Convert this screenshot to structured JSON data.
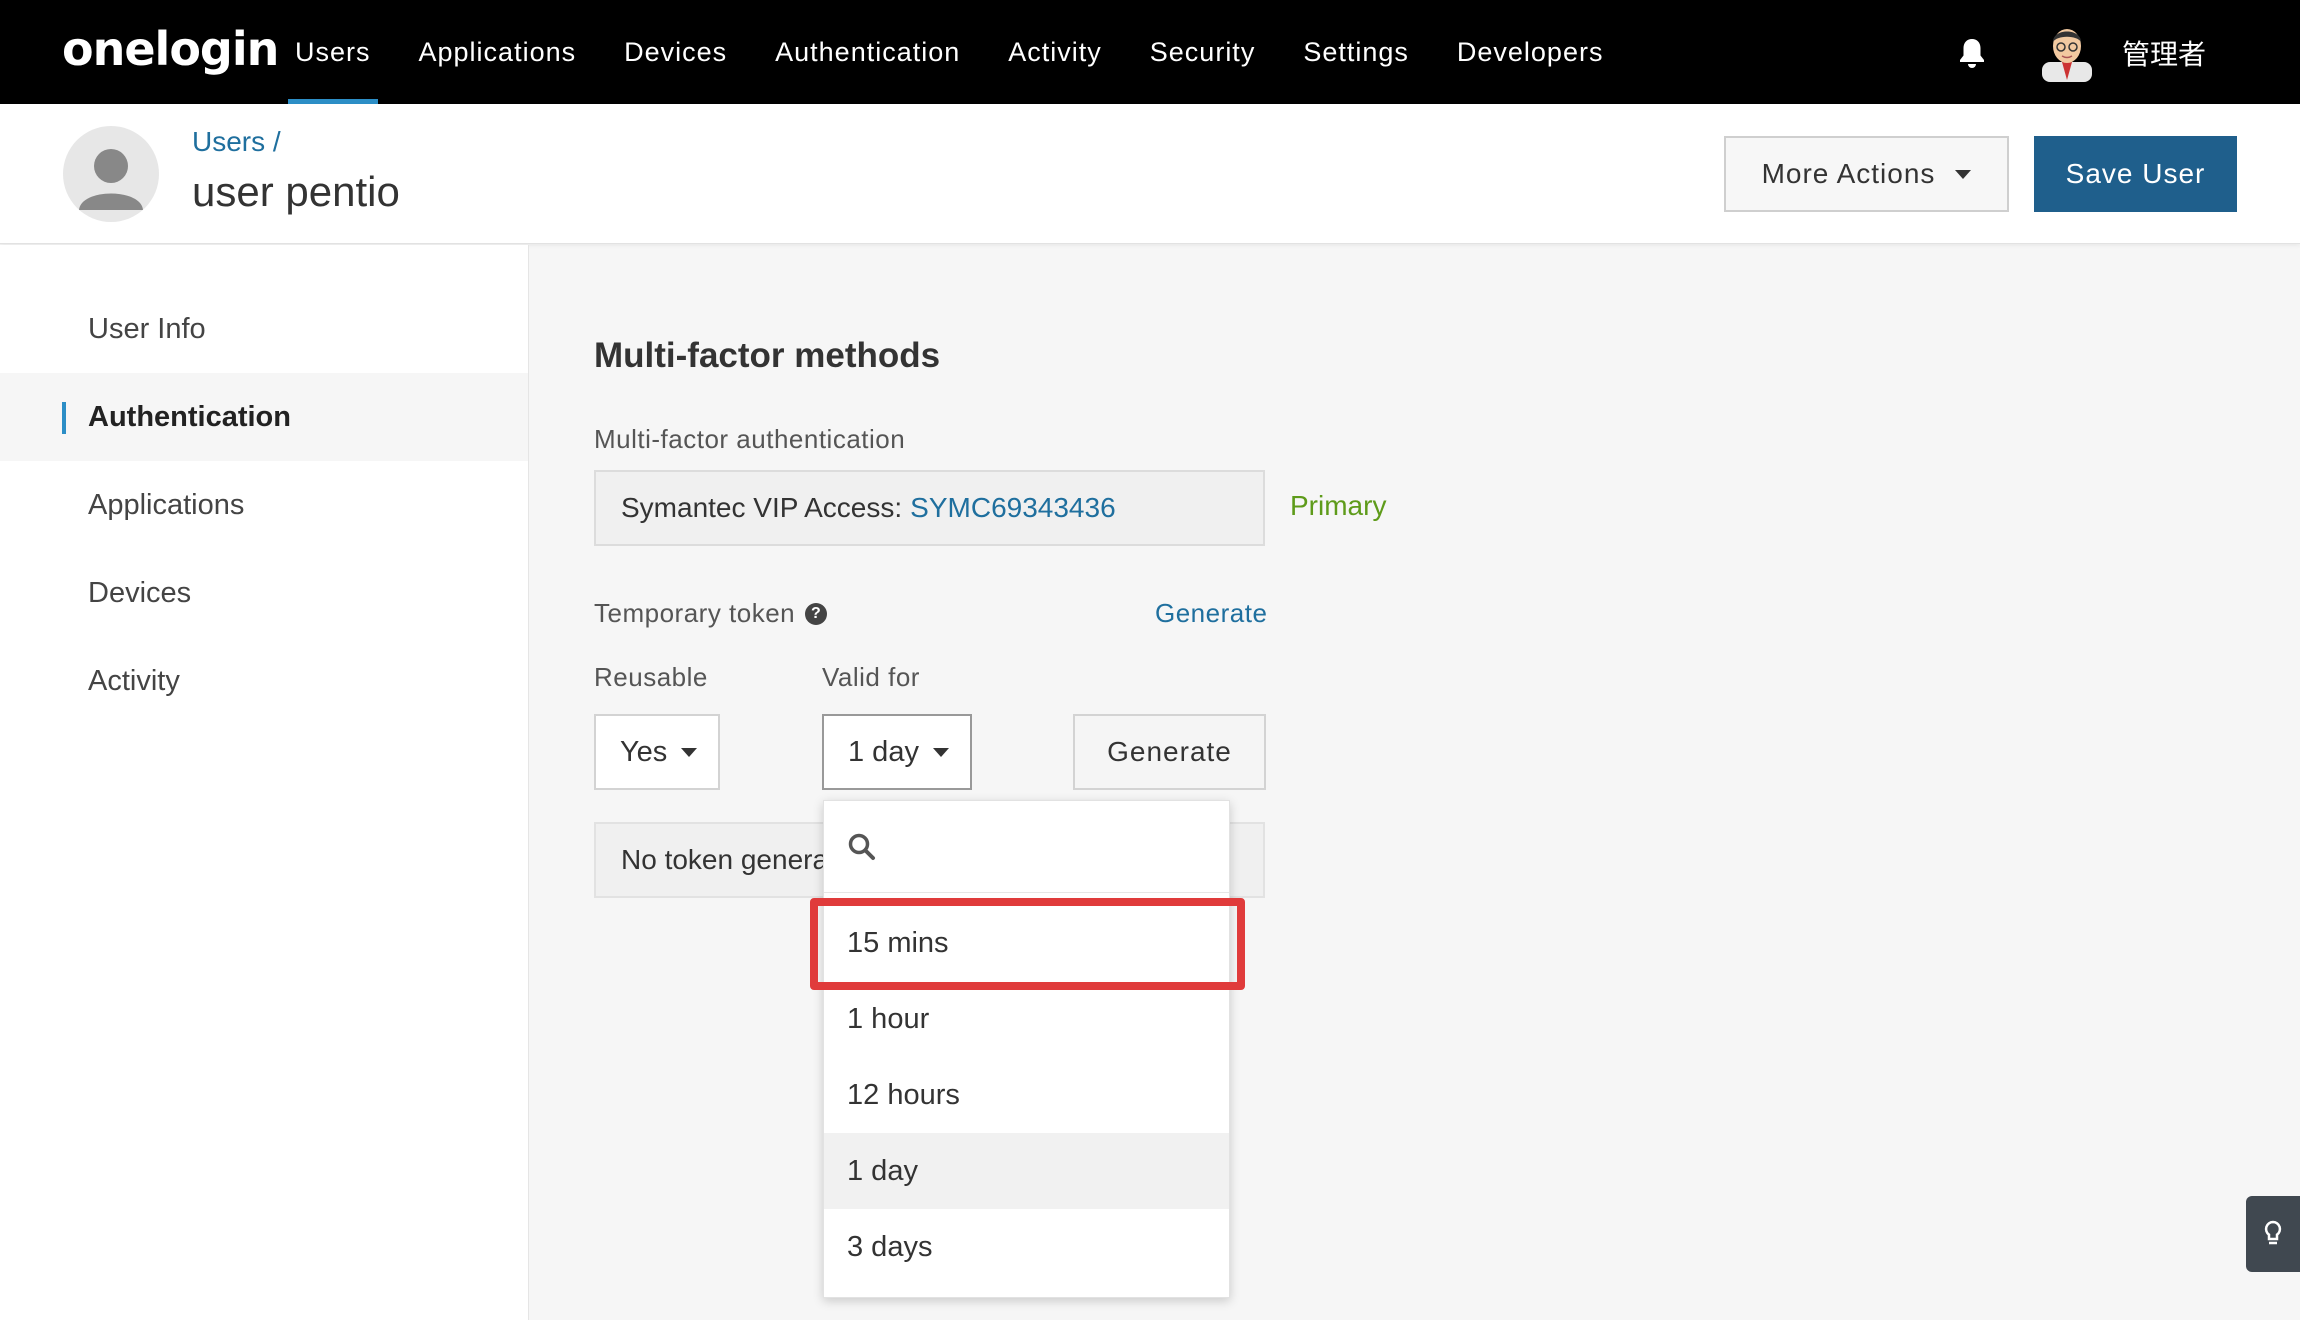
{
  "nav": {
    "logo": "onelogin",
    "items": [
      {
        "label": "Users",
        "active": true
      },
      {
        "label": "Applications"
      },
      {
        "label": "Devices"
      },
      {
        "label": "Authentication"
      },
      {
        "label": "Activity"
      },
      {
        "label": "Security"
      },
      {
        "label": "Settings"
      },
      {
        "label": "Developers"
      }
    ],
    "admin_name": "管理者"
  },
  "header": {
    "breadcrumb": "Users /",
    "title": "user pentio",
    "more_actions": "More Actions",
    "save_user": "Save User"
  },
  "sidebar": {
    "items": [
      {
        "label": "User Info"
      },
      {
        "label": "Authentication",
        "active": true
      },
      {
        "label": "Applications"
      },
      {
        "label": "Devices"
      },
      {
        "label": "Activity"
      }
    ]
  },
  "main": {
    "section_title": "Multi-factor methods",
    "mfa_label": "Multi-factor authentication",
    "mfa_device": "Symantec VIP Access:",
    "mfa_token": "SYMC69343436",
    "primary_label": "Primary",
    "temp_token_label": "Temporary token",
    "generate_link": "Generate",
    "reusable_label": "Reusable",
    "reusable_value": "Yes",
    "valid_for_label": "Valid for",
    "valid_for_value": "1 day",
    "generate_button": "Generate",
    "token_status": "No token genera"
  },
  "dropdown": {
    "search_placeholder": "",
    "options": [
      "15 mins",
      "1 hour",
      "12 hours",
      "1 day",
      "3 days"
    ],
    "selected": "1 day",
    "highlighted": "15 mins"
  },
  "colors": {
    "nav_bg": "#000000",
    "accent": "#2c8ec6",
    "save_button": "#1f5f8c",
    "link": "#1f6f9e",
    "primary_green": "#5e9b1a",
    "highlight_red": "#e03b3b"
  }
}
